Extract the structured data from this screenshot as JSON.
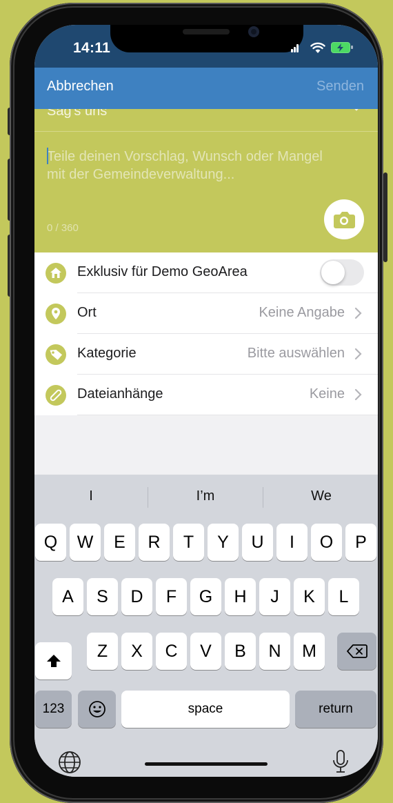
{
  "status": {
    "time": "14:11"
  },
  "navbar": {
    "cancel_label": "Abbrechen",
    "send_label": "Senden"
  },
  "form": {
    "topic_label": "Sag's uns",
    "placeholder": "Teile deinen Vorschlag, Wunsch oder Mangel mit der Gemeindeverwaltung...",
    "counter": "0 / 360"
  },
  "options": [
    {
      "label": "Exklusiv für Demo GeoArea",
      "icon": "home-icon",
      "toggle_on": false
    },
    {
      "label": "Ort",
      "value": "Keine Angabe",
      "icon": "location-pin-icon"
    },
    {
      "label": "Kategorie",
      "value": "Bitte auswählen",
      "icon": "tag-icon"
    },
    {
      "label": "Dateianhänge",
      "value": "Keine",
      "icon": "paperclip-icon"
    }
  ],
  "keyboard": {
    "suggestions": [
      "I",
      "I’m",
      "We"
    ],
    "row1": [
      "Q",
      "W",
      "E",
      "R",
      "T",
      "Y",
      "U",
      "I",
      "O",
      "P"
    ],
    "row2": [
      "A",
      "S",
      "D",
      "F",
      "G",
      "H",
      "J",
      "K",
      "L"
    ],
    "row3": [
      "Z",
      "X",
      "C",
      "V",
      "B",
      "N",
      "M"
    ],
    "numbers_key": "123",
    "space_key": "space",
    "return_key": "return"
  },
  "colors": {
    "accent_blue": "#3e81c1",
    "brand_green": "#c3c85c",
    "status_bar": "#1f4870"
  }
}
